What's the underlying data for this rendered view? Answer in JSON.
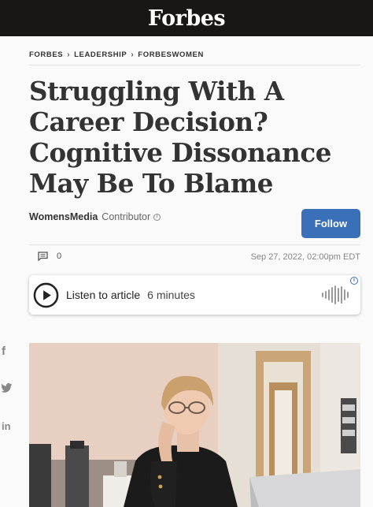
{
  "header": {
    "logo": "Forbes"
  },
  "breadcrumb": [
    "FORBES",
    "LEADERSHIP",
    "FORBESWOMEN"
  ],
  "article": {
    "headline": "Struggling With A Career Decision? Cognitive Dissonance May Be To Blame",
    "author": "WomensMedia",
    "author_role": "Contributor",
    "follow_label": "Follow",
    "comment_count": "0",
    "date": "Sep 27, 2022, 02:00pm EDT"
  },
  "listen": {
    "label": "Listen to article",
    "duration": "6 minutes"
  },
  "share": {
    "facebook": "f",
    "linkedin": "in"
  },
  "colors": {
    "topbar": "#181716",
    "accent": "#3970b8"
  }
}
